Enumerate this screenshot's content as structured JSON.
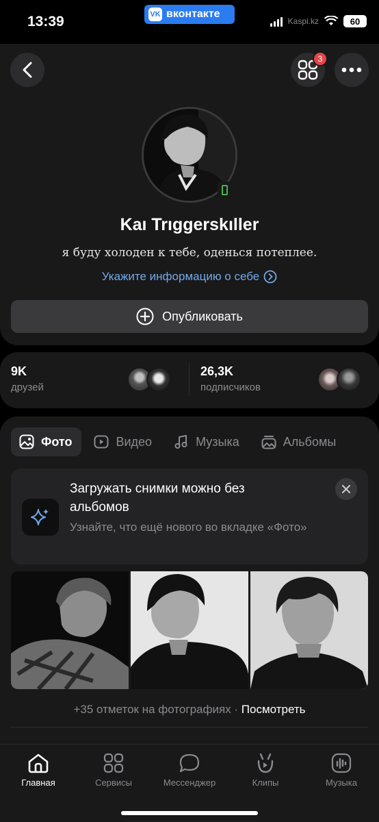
{
  "status_bar": {
    "time": "13:39",
    "app_badge": "вконтакте",
    "carrier": "Kaspi.kz",
    "battery": "60"
  },
  "profile": {
    "name": "Kaı Trıggerskıller",
    "status": "я буду холоден к тебе, оденься потеплее.",
    "info_link": "Укажите информацию о себе",
    "publish_label": "Опубликовать",
    "notification_count": "3"
  },
  "stats": {
    "friends_value": "9K",
    "friends_label": "друзей",
    "followers_value": "26,3K",
    "followers_label": "подписчиков"
  },
  "tabs": [
    {
      "label": "Фото",
      "icon": "photo-icon",
      "active": true
    },
    {
      "label": "Видео",
      "icon": "video-icon",
      "active": false
    },
    {
      "label": "Музыка",
      "icon": "music-icon",
      "active": false
    },
    {
      "label": "Альбомы",
      "icon": "albums-icon",
      "active": false
    }
  ],
  "promo": {
    "title": "Загружать снимки можно без альбомов",
    "description": "Узнайте, что ещё нового во вкладке «Фото»"
  },
  "photos": {
    "tagged_text": "+35 отметок на фотографиях · ",
    "tagged_link": "Посмотреть"
  },
  "bottom_nav": [
    {
      "label": "Главная",
      "icon": "home-icon",
      "active": true
    },
    {
      "label": "Сервисы",
      "icon": "services-icon",
      "active": false
    },
    {
      "label": "Мессенджер",
      "icon": "messenger-icon",
      "active": false
    },
    {
      "label": "Клипы",
      "icon": "clips-icon",
      "active": false
    },
    {
      "label": "Музыка",
      "icon": "music-icon",
      "active": false
    }
  ],
  "colors": {
    "background": "#000000",
    "card": "#19191a",
    "accent_link": "#71aaeb",
    "vk_blue": "#2b7cf0",
    "badge_red": "#e64646",
    "online_green": "#4bb34b"
  }
}
